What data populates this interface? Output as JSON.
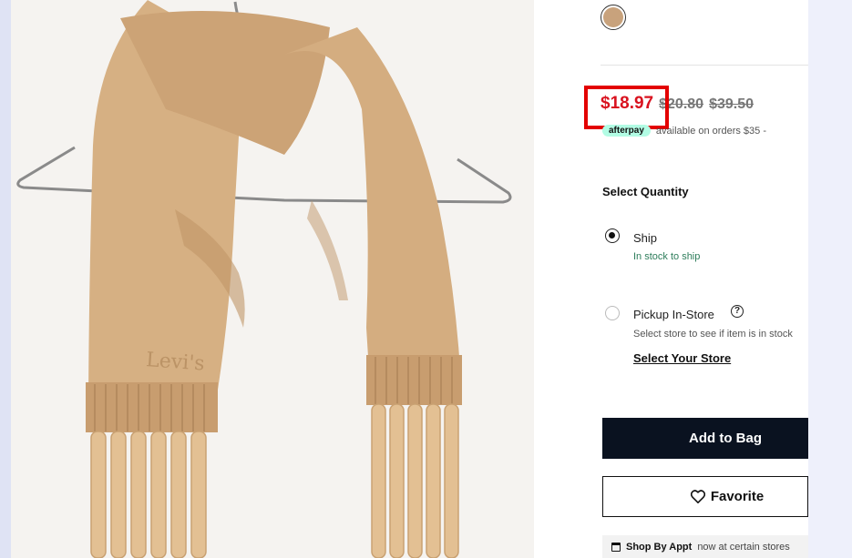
{
  "swatch": {
    "color": "#c8a27c",
    "icon": "color-swatch"
  },
  "price": {
    "sale": "$18.97",
    "old_prices": [
      "$20.80",
      "$39.50"
    ],
    "sale_color": "#d9121f"
  },
  "afterpay": {
    "badge": "afterpay",
    "text": "available on orders $35 -"
  },
  "quantity": {
    "label": "Select Quantity"
  },
  "fulfillment": {
    "ship": {
      "label": "Ship",
      "status": "In stock to ship",
      "selected": true
    },
    "pickup": {
      "label": "Pickup In-Store",
      "status": "Select store to see if item is in stock",
      "link": "Select Your Store",
      "info_icon": "?"
    }
  },
  "actions": {
    "add_to_bag": "Add to Bag",
    "favorite": "Favorite",
    "favorite_icon": "heart-icon"
  },
  "appointment": {
    "bold": "Shop By Appt",
    "text": "now at certain stores"
  },
  "colors": {
    "button_dark": "#0a1220",
    "highlight": "#e30000",
    "in_stock": "#2e7d5b",
    "afterpay_mint": "#b2fce4"
  }
}
